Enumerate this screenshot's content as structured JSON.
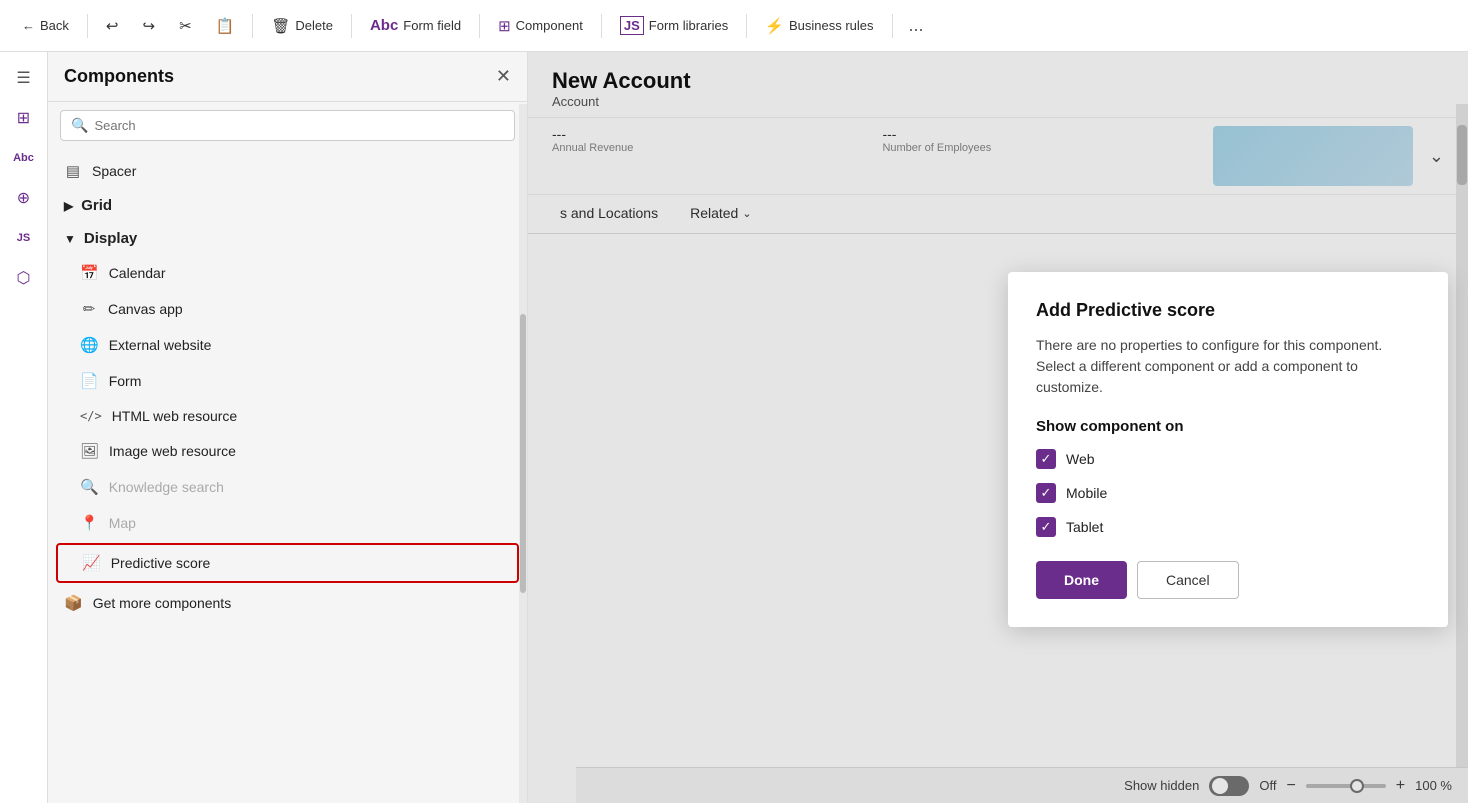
{
  "toolbar": {
    "back_label": "Back",
    "undo_label": "Undo",
    "redo_label": "Redo",
    "cut_label": "Cut",
    "paste_label": "Paste",
    "delete_label": "Delete",
    "form_field_label": "Form field",
    "component_label": "Component",
    "form_libraries_label": "Form libraries",
    "business_rules_label": "Business rules",
    "more_label": "..."
  },
  "sidebar": {
    "title": "Components",
    "search_placeholder": "Search",
    "sections": [
      {
        "name": "spacer",
        "label": "Spacer",
        "collapsed": true,
        "icon": "▤"
      },
      {
        "name": "grid",
        "label": "Grid",
        "collapsed": true,
        "icon": "▶",
        "expandable": true
      },
      {
        "name": "display",
        "label": "Display",
        "collapsed": false,
        "icon": "▼",
        "expandable": true
      }
    ],
    "display_items": [
      {
        "id": "calendar",
        "label": "Calendar",
        "icon": "📅",
        "disabled": false
      },
      {
        "id": "canvas-app",
        "label": "Canvas app",
        "icon": "✏",
        "disabled": false
      },
      {
        "id": "external-website",
        "label": "External website",
        "icon": "🌐",
        "disabled": false
      },
      {
        "id": "form",
        "label": "Form",
        "icon": "📄",
        "disabled": false
      },
      {
        "id": "html-web-resource",
        "label": "HTML web resource",
        "icon": "⟨/⟩",
        "disabled": false
      },
      {
        "id": "image-web-resource",
        "label": "Image web resource",
        "icon": "🖼",
        "disabled": false
      },
      {
        "id": "knowledge-search",
        "label": "Knowledge search",
        "icon": "🔍",
        "disabled": true
      },
      {
        "id": "map",
        "label": "Map",
        "icon": "📍",
        "disabled": true
      },
      {
        "id": "predictive-score",
        "label": "Predictive score",
        "icon": "📈",
        "disabled": false,
        "highlighted": true
      }
    ],
    "get_more": "Get more components"
  },
  "form": {
    "title": "New Account",
    "subtitle": "Account",
    "field1_label": "Annual Revenue",
    "field1_value": "---",
    "field2_label": "Number of Employees",
    "field2_value": "---",
    "tabs": [
      {
        "label": "s and Locations"
      },
      {
        "label": "Related"
      }
    ]
  },
  "modal": {
    "title": "Add Predictive score",
    "description": "There are no properties to configure for this component. Select a different component or add a component to customize.",
    "show_component_on": "Show component on",
    "checkboxes": [
      {
        "id": "web",
        "label": "Web",
        "checked": true
      },
      {
        "id": "mobile",
        "label": "Mobile",
        "checked": true
      },
      {
        "id": "tablet",
        "label": "Tablet",
        "checked": true
      }
    ],
    "done_label": "Done",
    "cancel_label": "Cancel"
  },
  "bottom_bar": {
    "show_hidden_label": "Show hidden",
    "toggle_state": "Off",
    "minus_label": "−",
    "plus_label": "+",
    "zoom_label": "100 %"
  }
}
